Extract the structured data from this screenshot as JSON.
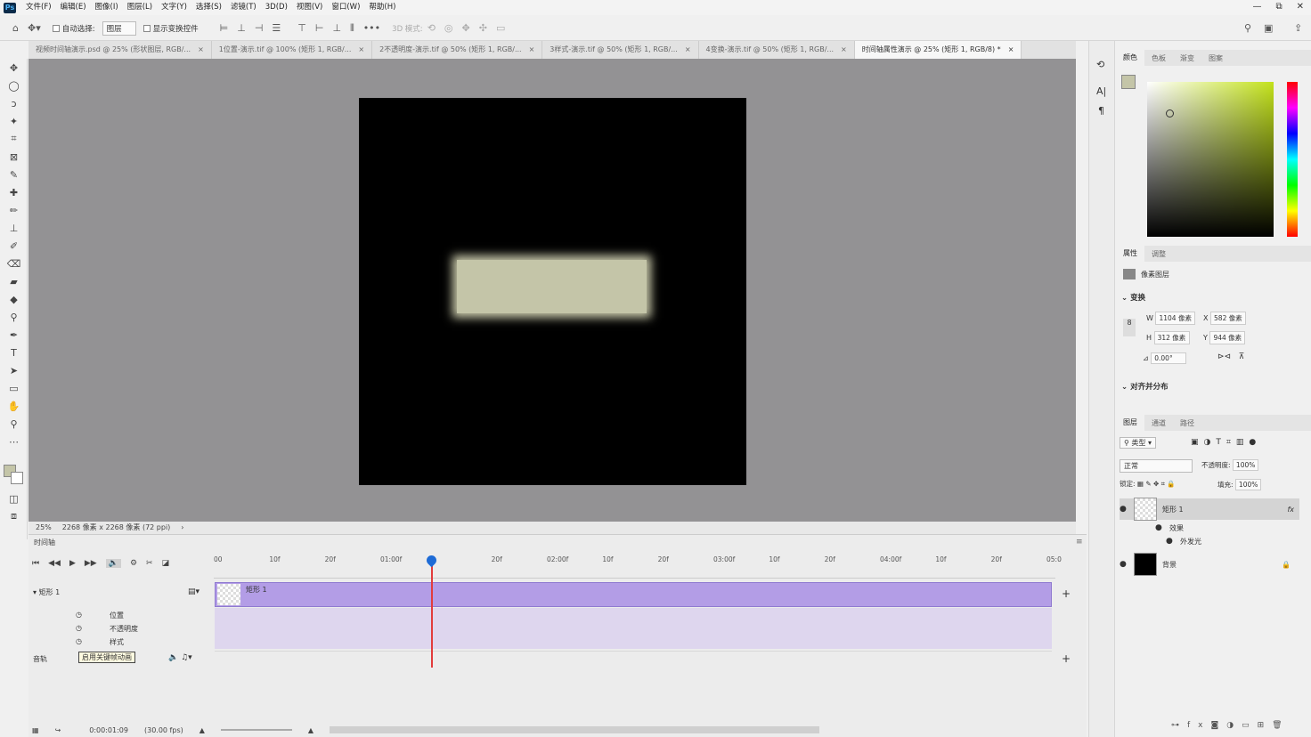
{
  "app": {
    "logo": "Ps"
  },
  "menu": [
    "文件(F)",
    "编辑(E)",
    "图像(I)",
    "图层(L)",
    "文字(Y)",
    "选择(S)",
    "滤镜(T)",
    "3D(D)",
    "视图(V)",
    "窗口(W)",
    "帮助(H)"
  ],
  "window_controls": {
    "minimize": "—",
    "restore": "⧉",
    "close": "✕"
  },
  "options": {
    "auto_select_label": "自动选择:",
    "auto_select_value": "图层",
    "show_transform_label": "显示变换控件",
    "mode3d_label": "3D 模式:"
  },
  "tabs": [
    {
      "label": "视频时间轴演示.psd @ 25% (形状图层, RGB/...",
      "close": "×"
    },
    {
      "label": "1位置-演示.tif @ 100% (矩形 1, RGB/...",
      "close": "×"
    },
    {
      "label": "2不透明度-演示.tif @ 50% (矩形 1, RGB/...",
      "close": "×"
    },
    {
      "label": "3样式-演示.tif @ 50% (矩形 1, RGB/...",
      "close": "×"
    },
    {
      "label": "4变换-演示.tif @ 50% (矩形 1, RGB/...",
      "close": "×"
    },
    {
      "label": "时间轴属性演示 @ 25% (矩形 1, RGB/8) *",
      "close": "×",
      "active": true
    }
  ],
  "tools": [
    "move-tool",
    "marquee-tool",
    "lasso-tool",
    "magic-wand-tool",
    "crop-tool",
    "frame-tool",
    "eyedropper-tool",
    "healing-tool",
    "brush-tool",
    "stamp-tool",
    "history-brush-tool",
    "eraser-tool",
    "gradient-tool",
    "blur-tool",
    "dodge-tool",
    "pen-tool",
    "type-tool",
    "path-select-tool",
    "rectangle-tool",
    "hand-tool",
    "zoom-tool",
    "more-tool"
  ],
  "tool_glyphs": [
    "✥",
    "◯",
    "ↄ",
    "✦",
    "⌗",
    "⊠",
    "✎",
    "✚",
    "✏",
    "⊥",
    "✐",
    "⌫",
    "▰",
    "◆",
    "⚲",
    "✒",
    "T",
    "➤",
    "▭",
    "✋",
    "⚲",
    "⋯"
  ],
  "status": {
    "zoom": "25%",
    "size": "2268 像素 x 2268 像素 (72 ppi)",
    "arrow": "›"
  },
  "timeline": {
    "title": "时间轴",
    "ruler": [
      "00",
      "10f",
      "20f",
      "01:00f",
      "",
      "20f",
      "02:00f",
      "10f",
      "20f",
      "03:00f",
      "10f",
      "20f",
      "04:00f",
      "10f",
      "20f",
      "05:0"
    ],
    "layer_name": "矩形 1",
    "clip_name": "矩形 1",
    "props": [
      "位置",
      "不透明度",
      "样式"
    ],
    "audio_label": "音轨",
    "tooltip": "启用关键帧动画",
    "timecode": "0:00:01:09",
    "fps": "(30.00 fps)",
    "add": "+"
  },
  "color_panel": {
    "tabs": [
      "颜色",
      "色板",
      "渐变",
      "图案"
    ],
    "fg": "#c4c5a8",
    "bg": "#ffffff"
  },
  "properties": {
    "tabs": [
      "属性",
      "调整"
    ],
    "type": "像素图层",
    "section": "变换",
    "w": "1104 像素",
    "x": "582 像素",
    "h": "312 像素",
    "y": "944 像素",
    "angle": "0.00°",
    "align_section": "对齐并分布",
    "labels": {
      "w": "W",
      "h": "H",
      "x": "X",
      "y": "Y"
    }
  },
  "layers": {
    "tabs": [
      "图层",
      "通道",
      "路径"
    ],
    "filter": "类型",
    "blend": "正常",
    "opacity_label": "不透明度:",
    "opacity": "100%",
    "lock_label": "锁定:",
    "fill_label": "填充:",
    "fill": "100%",
    "items": [
      {
        "name": "矩形 1",
        "fx": "fx"
      },
      {
        "name": "效果"
      },
      {
        "name": "外发光"
      },
      {
        "name": "背景"
      }
    ]
  }
}
